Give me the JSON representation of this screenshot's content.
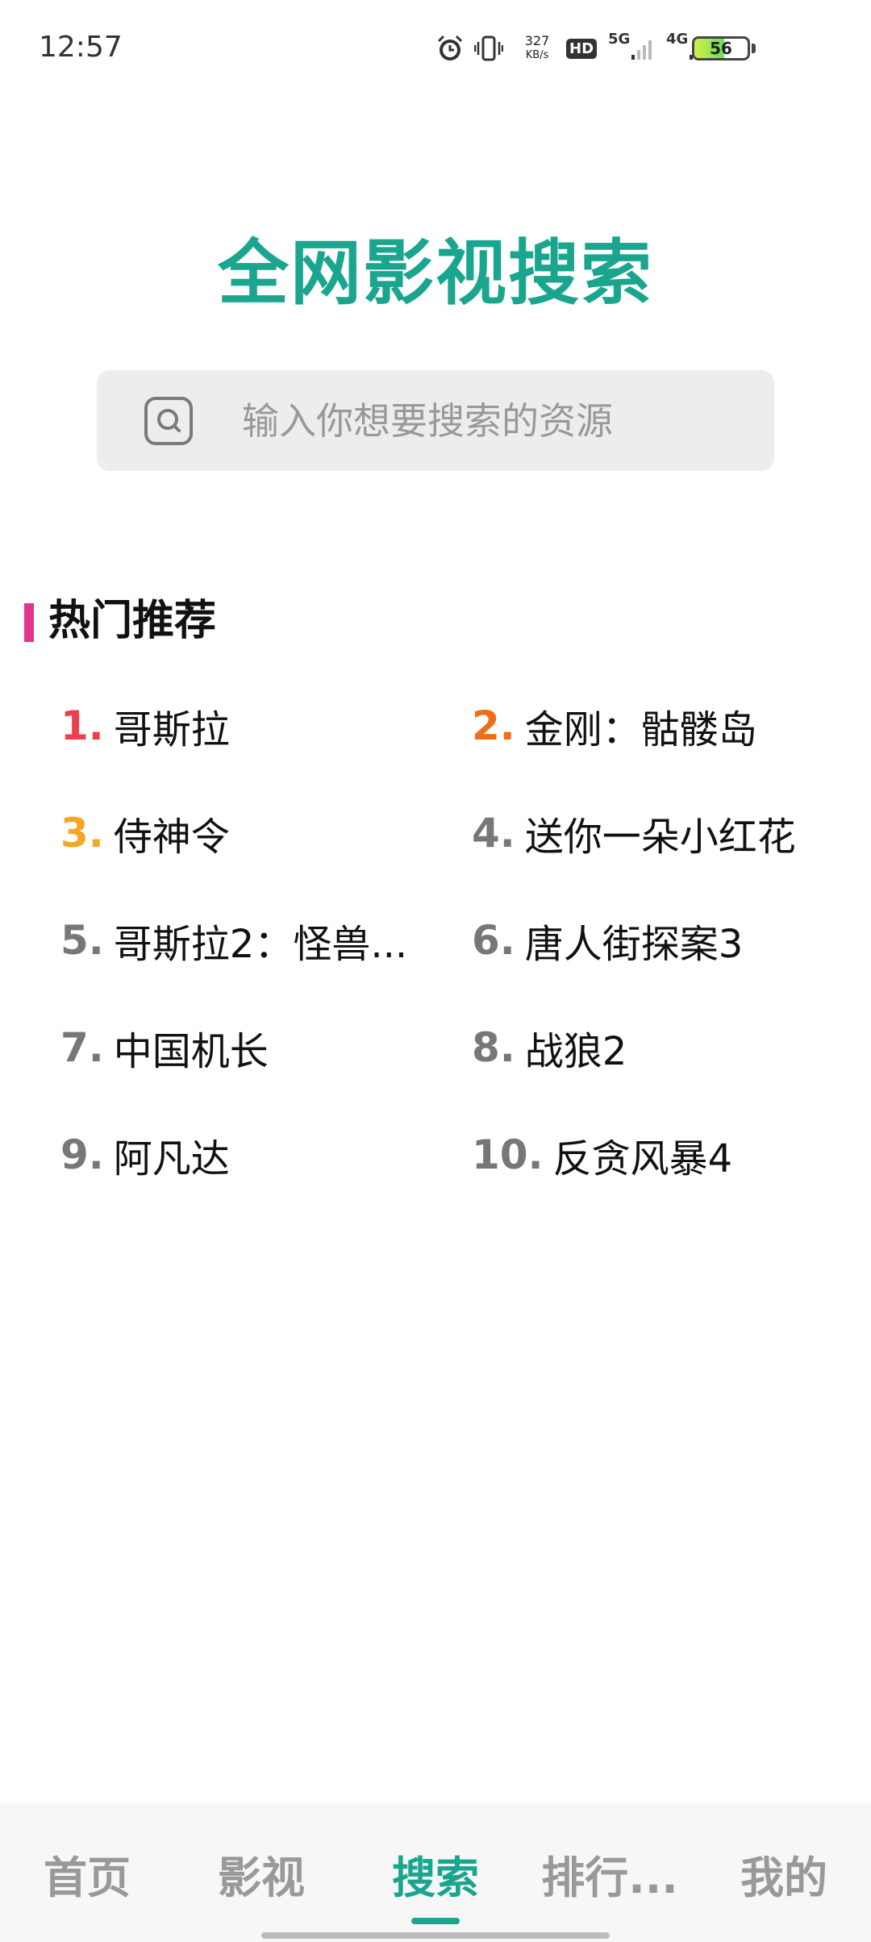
{
  "status_bar": {
    "time": "12:57",
    "net_speed_value": "327",
    "net_speed_unit": "KB/s",
    "hd_label": "HD",
    "net_5g": "5G",
    "net_4g": "4G",
    "battery_level": "56",
    "battery_fraction": 0.56
  },
  "title": "全网影视搜索",
  "search": {
    "placeholder": "输入你想要搜索的资源",
    "value": ""
  },
  "hot": {
    "title": "热门推荐",
    "items": [
      {
        "rank": "1.",
        "name": "哥斯拉"
      },
      {
        "rank": "2.",
        "name": "金刚：骷髅岛"
      },
      {
        "rank": "3.",
        "name": "侍神令"
      },
      {
        "rank": "4.",
        "name": "送你一朵小红花"
      },
      {
        "rank": "5.",
        "name": "哥斯拉2：怪兽..."
      },
      {
        "rank": "6.",
        "name": "唐人街探案3"
      },
      {
        "rank": "7.",
        "name": "中国机长"
      },
      {
        "rank": "8.",
        "name": "战狼2"
      },
      {
        "rank": "9.",
        "name": "阿凡达"
      },
      {
        "rank": "10.",
        "name": "反贪风暴4"
      }
    ]
  },
  "nav": {
    "items": [
      {
        "label": "首页"
      },
      {
        "label": "影视"
      },
      {
        "label": "搜索"
      },
      {
        "label": "排行..."
      },
      {
        "label": "我的"
      }
    ],
    "active_index": 2
  },
  "colors": {
    "accent": "#1aa58f",
    "rank1": "#ee3f4d",
    "rank2": "#f16d16",
    "rank3": "#f5a623",
    "section_bar": "#e0378b"
  },
  "icons": [
    "alarm-icon",
    "vibrate-icon",
    "hd-icon",
    "signal-icon",
    "battery-icon",
    "search-icon"
  ]
}
